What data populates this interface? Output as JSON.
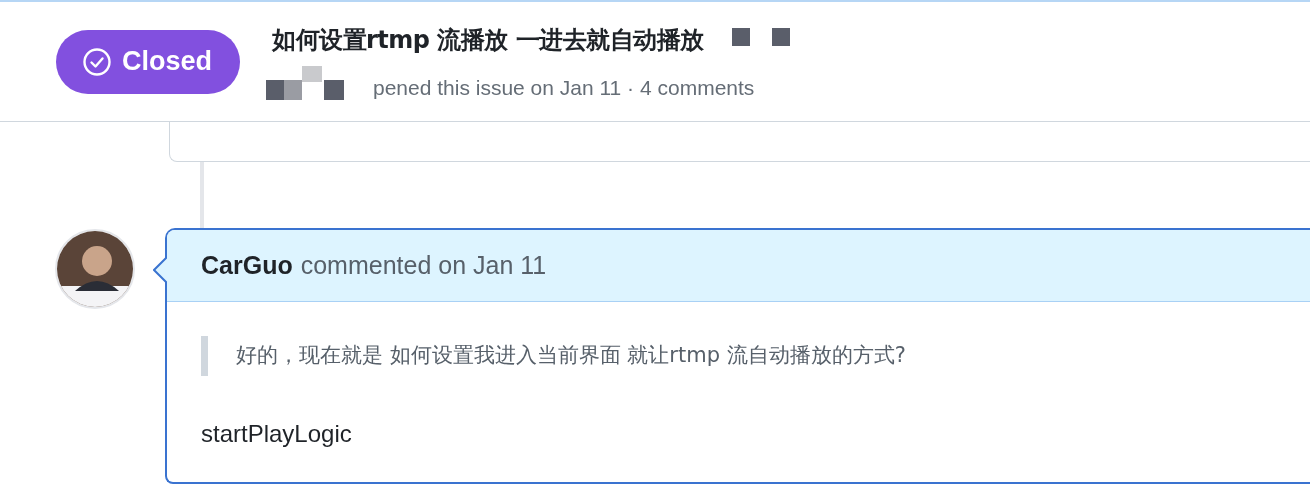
{
  "header": {
    "status": {
      "label": "Closed",
      "kind": "closed"
    },
    "title": "如何设置rtmp 流播放 一进去就自动播放",
    "meta": "pened this issue on Jan 11 · 4 comments"
  },
  "comment": {
    "author": "CarGuo",
    "action": "commented on Jan 11",
    "quote": "好的，现在就是 如何设置我进入当前界面 就让rtmp 流自动播放的方式?",
    "body": "startPlayLogic"
  }
}
